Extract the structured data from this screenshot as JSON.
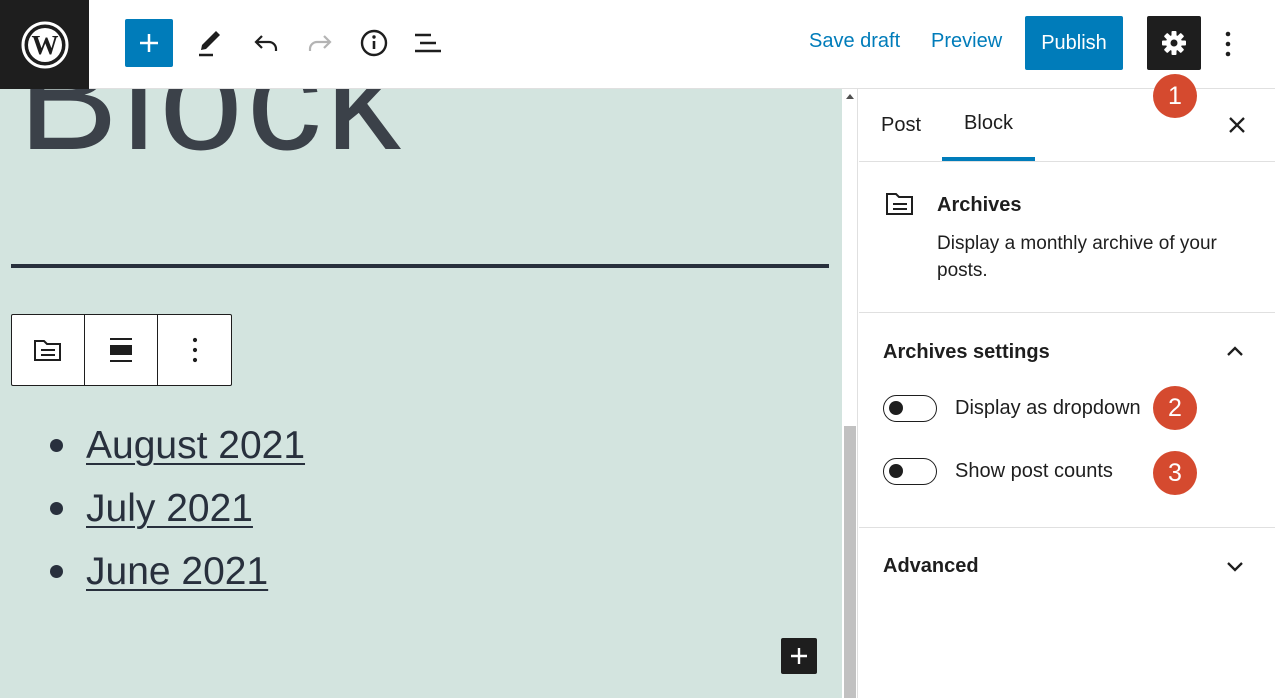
{
  "toolbar": {
    "save_draft": "Save draft",
    "preview": "Preview",
    "publish": "Publish",
    "icons": [
      "wordpress-logo",
      "add-block",
      "edit-tools",
      "undo",
      "redo",
      "details-info",
      "list-view",
      "settings-gear",
      "more-options"
    ]
  },
  "editor": {
    "title_fragment": "Block",
    "archives": [
      "August 2021",
      "July 2021",
      "June 2021"
    ]
  },
  "sidebar": {
    "tabs": [
      "Post",
      "Block"
    ],
    "active_tab": "Block",
    "block_name": "Archives",
    "block_description": "Display a monthly archive of your posts.",
    "settings_title": "Archives settings",
    "toggles": [
      {
        "label": "Display as dropdown",
        "on": false
      },
      {
        "label": "Show post counts",
        "on": false
      }
    ],
    "advanced_title": "Advanced"
  },
  "annotations": [
    "1",
    "2",
    "3"
  ],
  "colors": {
    "accent": "#007cba",
    "dark": "#1e1e1e",
    "canvas_bg": "#d3e4df",
    "text_dark": "#28303d",
    "badge": "#d54a2f"
  }
}
